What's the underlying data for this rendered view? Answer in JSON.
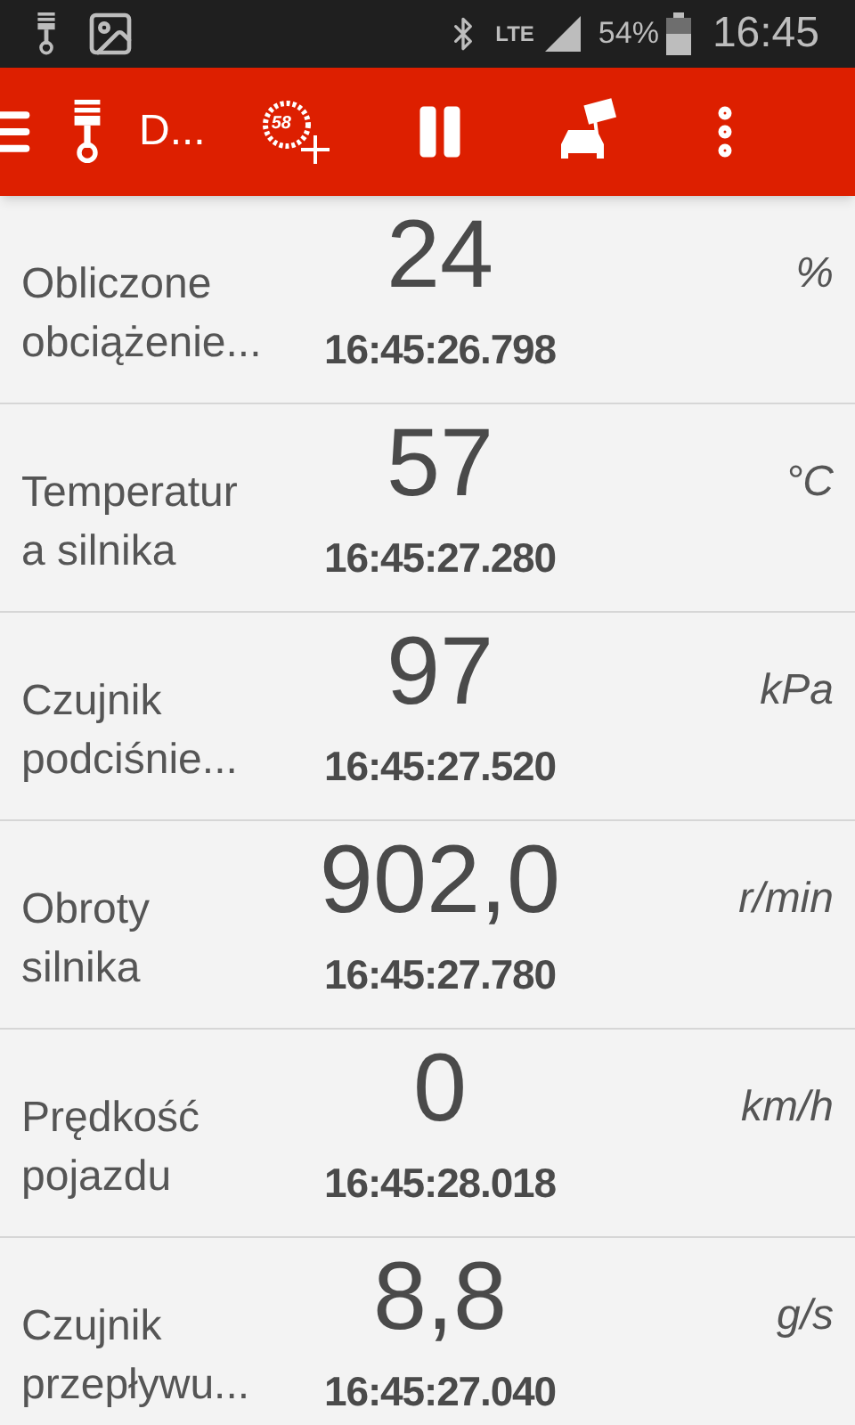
{
  "status_bar": {
    "network": "LTE",
    "battery": "54%",
    "time": "16:45"
  },
  "toolbar": {
    "title": "D...",
    "gauge_number": "58"
  },
  "sensors": [
    {
      "name": "Obliczone\nobciążenie...",
      "value": "24",
      "timestamp": "16:45:26.798",
      "unit": "%"
    },
    {
      "name": "Temperatur\na silnika",
      "value": "57",
      "timestamp": "16:45:27.280",
      "unit": "°C"
    },
    {
      "name": "Czujnik\npodciśnie...",
      "value": "97",
      "timestamp": "16:45:27.520",
      "unit": "kPa"
    },
    {
      "name": "Obroty\nsilnika",
      "value": "902,0",
      "timestamp": "16:45:27.780",
      "unit": "r/min"
    },
    {
      "name": "Prędkość\npojazdu",
      "value": "0",
      "timestamp": "16:45:28.018",
      "unit": "km/h"
    },
    {
      "name": "Czujnik\nprzepływu...",
      "value": "8,8",
      "timestamp": "16:45:27.040",
      "unit": "g/s"
    }
  ]
}
